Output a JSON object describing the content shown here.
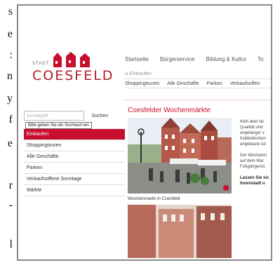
{
  "left_text": [
    "s",
    "e",
    ":",
    "n",
    "y",
    "f",
    "e",
    "r",
    "-",
    "l"
  ],
  "logo": {
    "stadt": "STADT",
    "name": "COESFELD"
  },
  "topnav": [
    "Startseite",
    "Bürgerservice",
    "Bildung & Kultur",
    "To"
  ],
  "breadcrumb": {
    "home_icon": "home-icon",
    "text": "Einkaufen"
  },
  "subnav": [
    "Shoppingtouren",
    "Alle Geschäfte",
    "Parken",
    "Verkaufsoffen"
  ],
  "search": {
    "placeholder": "Suchbegriff",
    "button": "Suchen",
    "tooltip": "Bitte geben Sie ein Suchwort ein"
  },
  "sidemenu": [
    {
      "label": "Einkaufen",
      "active": true
    },
    {
      "label": "Shoppingtouren",
      "active": false
    },
    {
      "label": "Alle Geschäfte",
      "active": false
    },
    {
      "label": "Parken",
      "active": false
    },
    {
      "label": "Verkaufsoffene Sonntage",
      "active": false
    },
    {
      "label": "Märkte",
      "active": false
    }
  ],
  "content": {
    "title": "Coesfelder Wochenmärkte",
    "caption": "Wochenmarkt in Coesfeld",
    "right_lines": [
      "Kleh aber fei",
      "Qualität und",
      "angelanger v",
      "holländischen",
      "angebaute od",
      "",
      "Der Wochenm",
      "auf dem Mar",
      "Fußgängerzo",
      "",
      "Lassen Sie sic",
      "Innenstadt u"
    ]
  },
  "colors": {
    "accent": "#c8102e"
  }
}
